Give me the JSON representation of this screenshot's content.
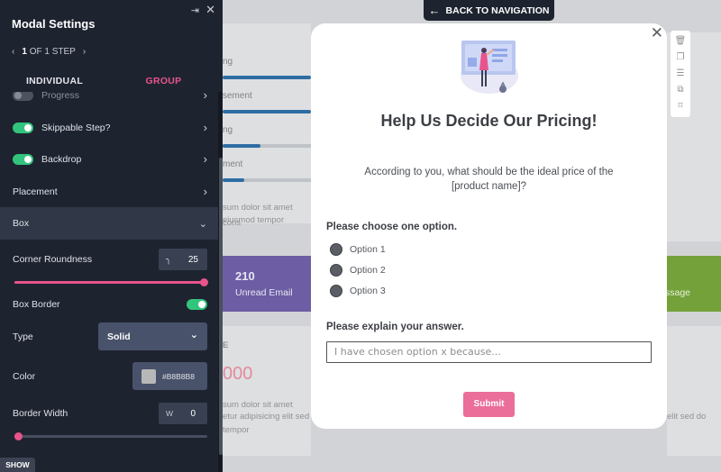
{
  "panel": {
    "title": "Modal Settings",
    "step_label": "OF 1 STEP",
    "step_current": "1",
    "tabs": [
      "INDIVIDUAL",
      "GROUP"
    ],
    "rows": {
      "progress": "Progress",
      "skippable": "Skippable Step?",
      "backdrop": "Backdrop",
      "placement": "Placement",
      "box": "Box",
      "corner_roundness": "Corner Roundness",
      "corner_value": "25",
      "box_border": "Box Border",
      "type": "Type",
      "type_value": "Solid",
      "color": "Color",
      "color_value": "#B8B8B8",
      "border_width": "Border Width",
      "border_width_prefix": "W",
      "border_width_value": "0"
    },
    "toggles": {
      "progress": false,
      "skippable": true,
      "backdrop": true,
      "box_border": true
    },
    "sliders": {
      "corner_roundness": 1.0,
      "border_width": 0.0
    },
    "show_button": "SHOW"
  },
  "nav": {
    "back_label": "BACK TO NAVIGATION"
  },
  "modal": {
    "title": "Help Us Decide Our Pricing!",
    "question": "According to you, what should be the ideal price of the [product name]?",
    "choose_label": "Please choose one option.",
    "options": [
      "Option 1",
      "Option 2",
      "Option 3"
    ],
    "explain_label": "Please explain your answer.",
    "input_placeholder": "I have chosen option x because...",
    "submit_label": "Submit"
  },
  "background": {
    "progress_labels": [
      "ng",
      "sement",
      "ng",
      "ment"
    ],
    "lorem_1": "sum dolor sit amet cons",
    "lorem_2": "eiusmod tempor",
    "unread_value": "210",
    "unread_label": "Unread Email",
    "green_label": "ssage",
    "big_value": "000",
    "e_label": "E",
    "lorem_3": "sum dolor sit amet",
    "lorem_4": "etur adipisicing elit sed do",
    "lorem_5": "tempor",
    "lorem_6": "elit sed do",
    "lorem_7": "elit sed do"
  },
  "colors": {
    "accent_pink": "#e7548b",
    "toggle_green": "#32c47c",
    "panel_bg": "#1e2330",
    "unread_purple": "#6c5da4",
    "message_green": "#74a13a"
  },
  "icons": [
    "close-icon",
    "pin-icon",
    "chevron-left-icon",
    "chevron-right-icon",
    "chevron-down-icon",
    "arrow-left-icon",
    "trash-icon",
    "copy-icon",
    "sliders-icon",
    "duplicate-icon",
    "bookmark-icon",
    "corner-icon"
  ]
}
